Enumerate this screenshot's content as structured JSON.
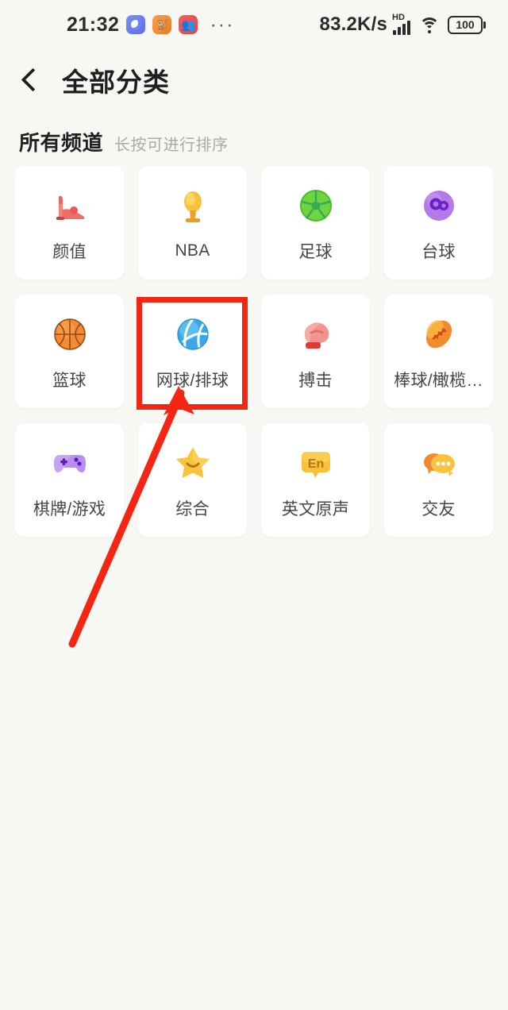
{
  "statusbar": {
    "time": "21:32",
    "notification_icons": [
      "app-icon-blue",
      "app-icon-orange",
      "app-icon-red"
    ],
    "overflow": "···",
    "network_speed": "83.2K/s",
    "hd_label": "HD",
    "signal_icon": "signal-bars-icon",
    "wifi_icon": "wifi-icon",
    "battery_level": "100"
  },
  "navbar": {
    "back_icon": "chevron-left-icon",
    "title": "全部分类"
  },
  "section": {
    "title": "所有频道",
    "subtitle": "长按可进行排序"
  },
  "channels": [
    {
      "label": "颜值",
      "icon": "high-heel-icon"
    },
    {
      "label": "NBA",
      "icon": "trophy-icon"
    },
    {
      "label": "足球",
      "icon": "soccer-ball-icon"
    },
    {
      "label": "台球",
      "icon": "billiard-ball-icon"
    },
    {
      "label": "篮球",
      "icon": "basketball-icon"
    },
    {
      "label": "网球/排球",
      "icon": "volleyball-icon"
    },
    {
      "label": "搏击",
      "icon": "boxing-glove-icon"
    },
    {
      "label": "棒球/橄榄…",
      "icon": "football-icon"
    },
    {
      "label": "棋牌/游戏",
      "icon": "gamepad-icon"
    },
    {
      "label": "综合",
      "icon": "smiling-star-icon"
    },
    {
      "label": "英文原声",
      "icon": "en-bubble-icon"
    },
    {
      "label": "交友",
      "icon": "chat-bubbles-icon"
    }
  ],
  "annotation": {
    "color": "#f22613",
    "highlight_target": "网球/排球",
    "arrow": "red-arrow-pointing-to-tennis-volleyball-card"
  },
  "colors": {
    "background": "#f7f7f3",
    "card": "#ffffff",
    "title_text": "#1f1f1f",
    "label_text": "#46464a",
    "subtitle_text": "#aaaaa6",
    "annotation_red": "#f22613"
  }
}
